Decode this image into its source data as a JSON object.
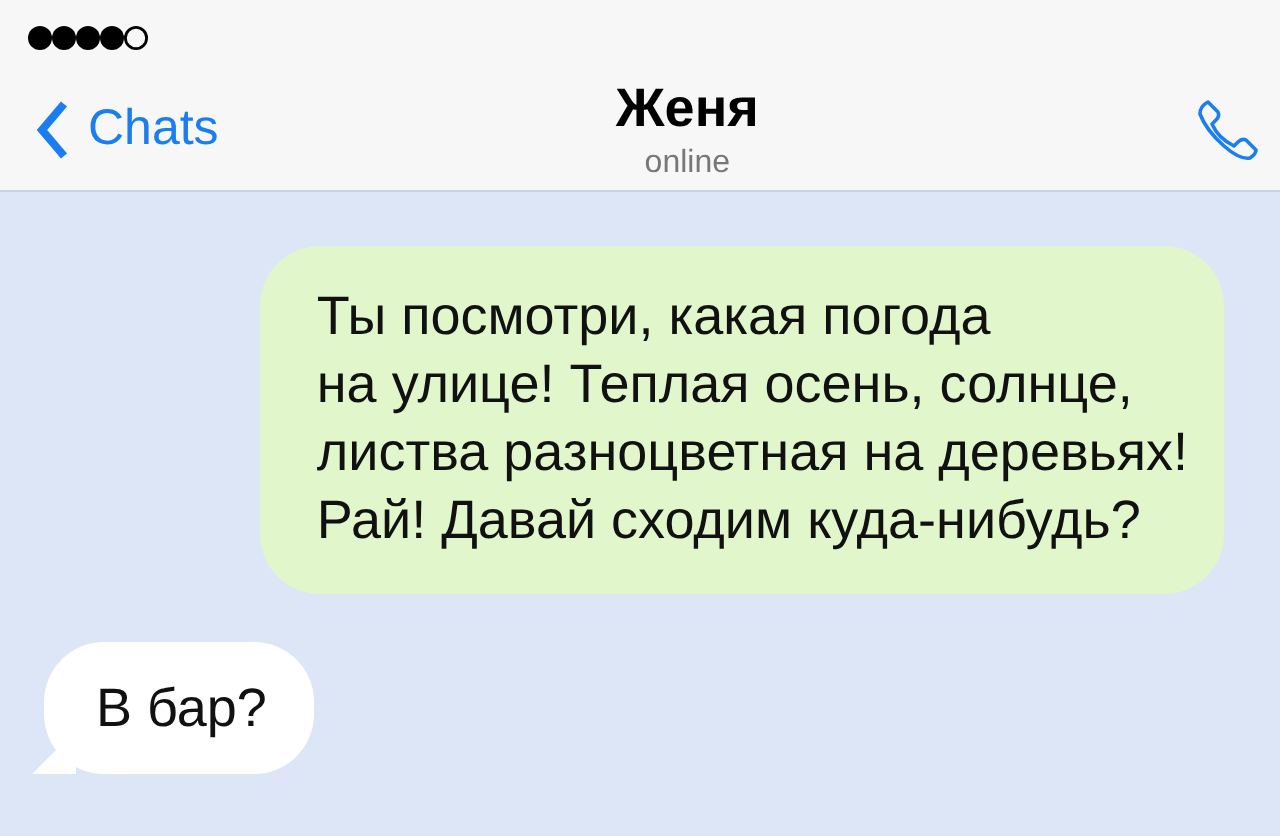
{
  "header": {
    "back_label": "Chats",
    "contact_name": "Женя",
    "contact_status": "online"
  },
  "messages": [
    {
      "kind": "outgoing",
      "text": "Ты посмотри, какая погода\nна улице! Теплая осень, солнце,\nлиства разноцветная на деревьях!\nРай! Давай сходим куда-нибудь?"
    },
    {
      "kind": "incoming",
      "text": "В бар?"
    }
  ]
}
